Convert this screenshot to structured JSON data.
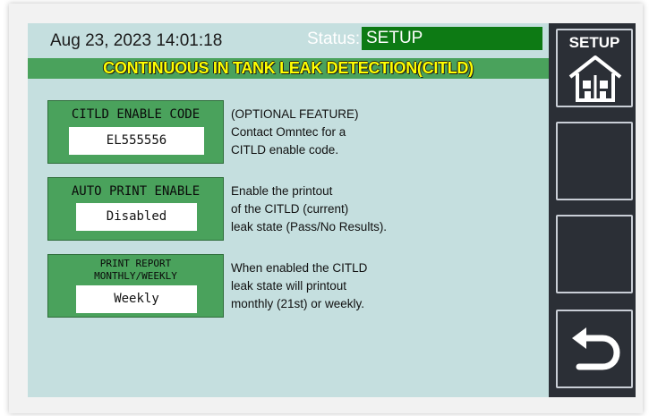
{
  "header": {
    "datetime": "Aug 23, 2023 14:01:18",
    "status_label": "Status:",
    "status_value": "SETUP"
  },
  "title": "CONTINUOUS IN TANK LEAK DETECTION(CITLD)",
  "fields": [
    {
      "label": "CITLD ENABLE CODE",
      "value": "EL555556",
      "desc": [
        "(OPTIONAL FEATURE)",
        "Contact Omntec for a",
        "CITLD enable code."
      ]
    },
    {
      "label": "AUTO PRINT ENABLE",
      "value": "Disabled",
      "desc": [
        "Enable the printout",
        "of the CITLD (current)",
        "leak state (Pass/No Results)."
      ]
    },
    {
      "label_lines": [
        "PRINT REPORT",
        "MONTHLY/WEEKLY"
      ],
      "value": "Weekly",
      "desc": [
        "When enabled the CITLD",
        "leak state will printout",
        "monthly (21st) or weekly."
      ]
    }
  ],
  "sidebar": {
    "setup_label": "SETUP",
    "icons": [
      "home-icon",
      "back-arrow-icon"
    ]
  },
  "colors": {
    "screen_bg": "#c5dfdf",
    "green": "#4aa25c",
    "status_green": "#0d7a14",
    "title_text": "#ffff00",
    "sidebar_bg": "#2b2f36"
  }
}
